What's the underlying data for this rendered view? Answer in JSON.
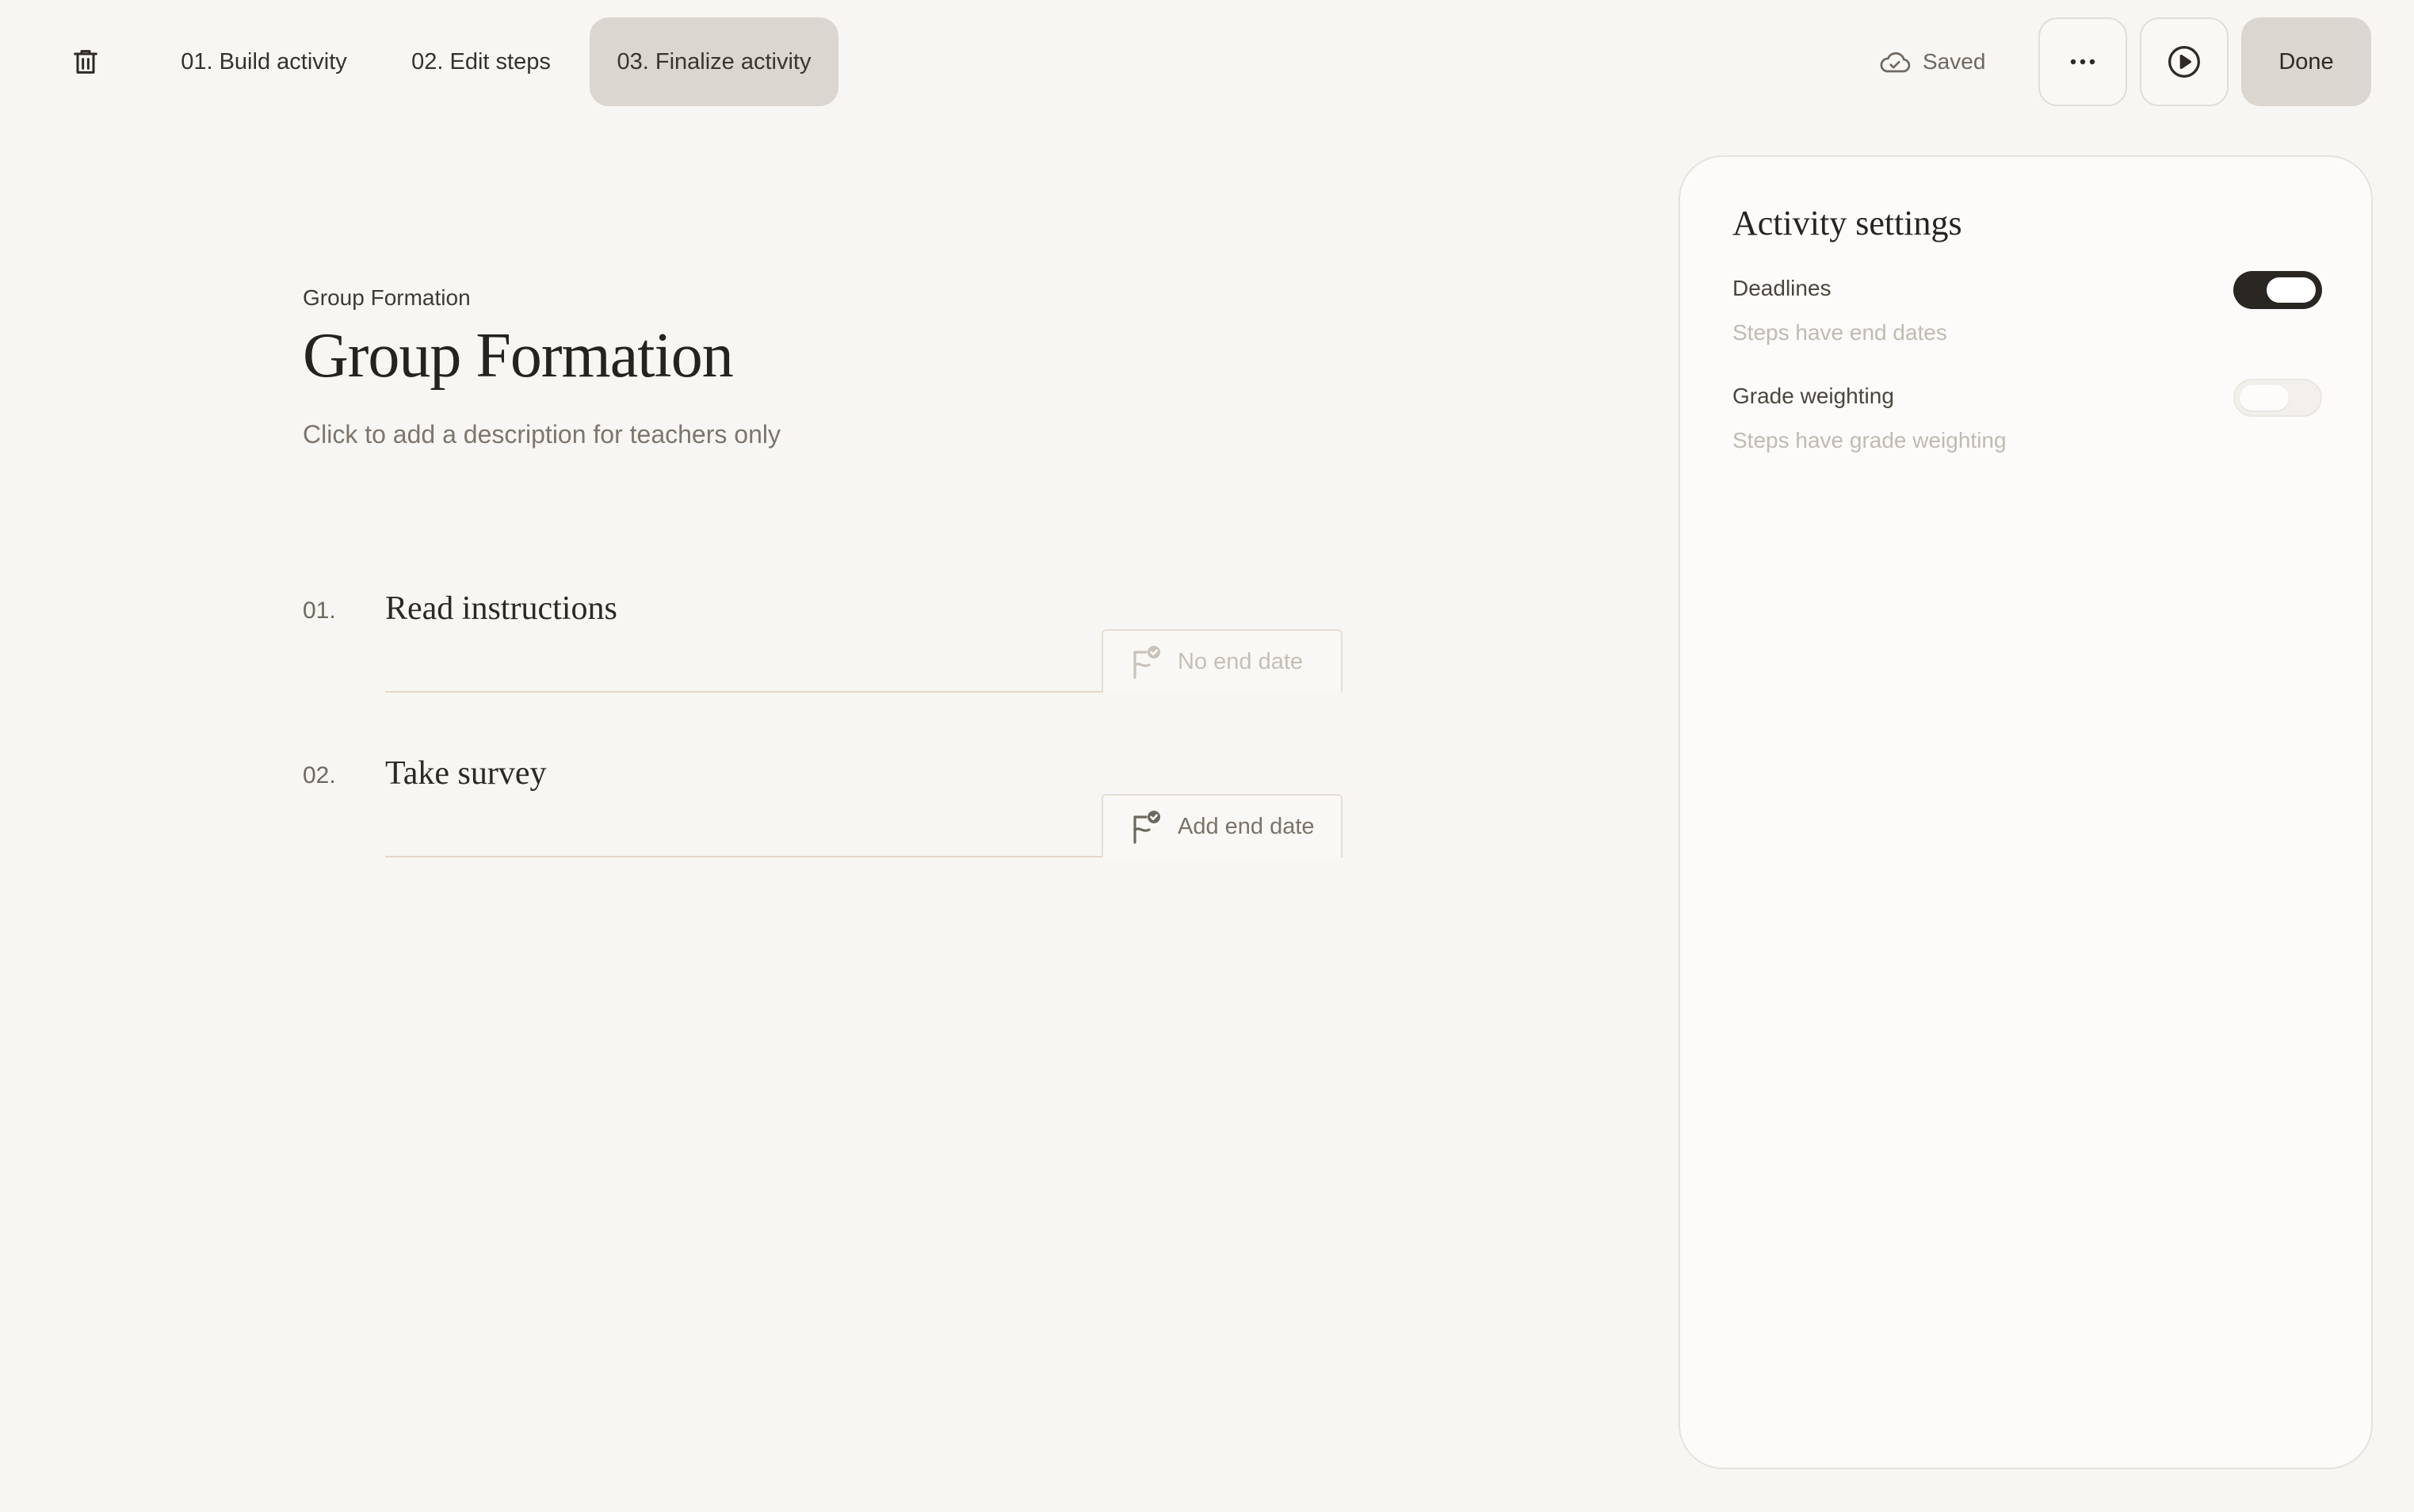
{
  "toolbar": {
    "trash_icon": "trash-icon",
    "tabs": [
      {
        "label": "01. Build activity",
        "active": false
      },
      {
        "label": "02. Edit steps",
        "active": false
      },
      {
        "label": "03. Finalize activity",
        "active": true
      }
    ],
    "saved_icon": "cloud-icon",
    "saved_label": "Saved",
    "more_icon": "more-icon",
    "play_icon": "play-icon",
    "done_label": "Done"
  },
  "main": {
    "breadcrumb": "Group Formation",
    "title": "Group Formation",
    "description_placeholder": "Click to add a description for teachers only",
    "steps": [
      {
        "number": "01.",
        "title": "Read instructions",
        "date_label": "No end date",
        "date_enabled": false
      },
      {
        "number": "02.",
        "title": "Take survey",
        "date_label": "Add end date",
        "date_enabled": true
      }
    ]
  },
  "settings": {
    "title": "Activity settings",
    "items": [
      {
        "label": "Deadlines",
        "description": "Steps have end dates",
        "enabled": true
      },
      {
        "label": "Grade weighting",
        "description": "Steps have grade weighting",
        "enabled": false
      }
    ]
  },
  "colors": {
    "background": "#f8f6f2",
    "active_tab": "#dbd6d0",
    "toggle_on": "#2a2622",
    "divider": "#e3d8c8"
  }
}
